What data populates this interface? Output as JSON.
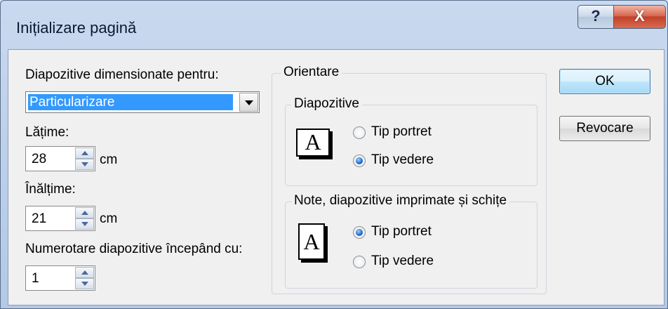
{
  "window": {
    "title": "Inițializare pagină"
  },
  "titlebar": {
    "help_label": "?",
    "close_label": "X"
  },
  "slides_sized_for": {
    "label": "Diapozitive dimensionate pentru:",
    "value": "Particularizare"
  },
  "width": {
    "label": "Lățime:",
    "value": "28",
    "unit": "cm"
  },
  "height": {
    "label": "Înălțime:",
    "value": "21",
    "unit": "cm"
  },
  "numbering": {
    "label": "Numerotare diapozitive începând cu:",
    "value": "1"
  },
  "orientation": {
    "label": "Orientare",
    "slides": {
      "label": "Diapozitive",
      "icon_letter": "A",
      "portrait_label": "Tip portret",
      "landscape_label": "Tip vedere",
      "selected": "landscape"
    },
    "notes": {
      "label": "Note, diapozitive imprimate și schițe",
      "icon_letter": "A",
      "portrait_label": "Tip portret",
      "landscape_label": "Tip vedere",
      "selected": "portrait"
    }
  },
  "buttons": {
    "ok": "OK",
    "cancel": "Revocare"
  }
}
